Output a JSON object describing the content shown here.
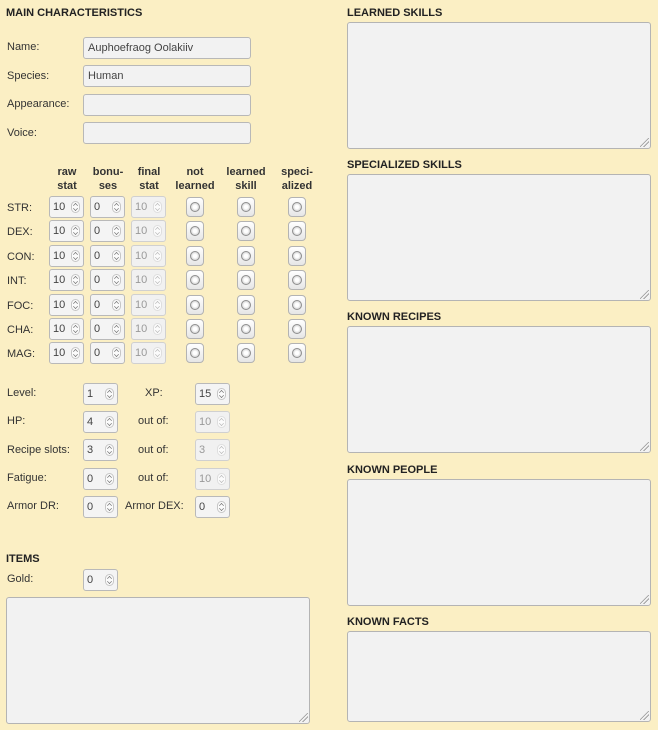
{
  "main": {
    "title": "MAIN CHARACTERISTICS",
    "fields": [
      {
        "label": "Name:",
        "value": "Auphoefraog Oolakiiv"
      },
      {
        "label": "Species:",
        "value": "Human"
      },
      {
        "label": "Appearance:",
        "value": ""
      },
      {
        "label": "Voice:",
        "value": ""
      }
    ]
  },
  "stats": {
    "headers": {
      "raw": [
        "raw",
        "stat"
      ],
      "bonuses": [
        "bonu-",
        "ses"
      ],
      "final": [
        "final",
        "stat"
      ],
      "not_learned": [
        "not",
        "learned"
      ],
      "learned": [
        "learned",
        "skill"
      ],
      "specialized": [
        "speci-",
        "alized"
      ]
    },
    "rows": [
      {
        "label": "STR:",
        "raw": "10",
        "bonus": "0",
        "final": "10"
      },
      {
        "label": "DEX:",
        "raw": "10",
        "bonus": "0",
        "final": "10"
      },
      {
        "label": "CON:",
        "raw": "10",
        "bonus": "0",
        "final": "10"
      },
      {
        "label": "INT:",
        "raw": "10",
        "bonus": "0",
        "final": "10"
      },
      {
        "label": "FOC:",
        "raw": "10",
        "bonus": "0",
        "final": "10"
      },
      {
        "label": "CHA:",
        "raw": "10",
        "bonus": "0",
        "final": "10"
      },
      {
        "label": "MAG:",
        "raw": "10",
        "bonus": "0",
        "final": "10"
      }
    ]
  },
  "progress": {
    "level_label": "Level:",
    "level": "1",
    "xp_label": "XP:",
    "xp": "15",
    "hp_label": "HP:",
    "hp": "4",
    "hp_outof_label": "out of:",
    "hp_max": "10",
    "recipe_label": "Recipe slots:",
    "recipe": "3",
    "recipe_outof_label": "out of:",
    "recipe_max": "3",
    "fatigue_label": "Fatigue:",
    "fatigue": "0",
    "fatigue_outof_label": "out of:",
    "fatigue_max": "10",
    "armor_dr_label": "Armor DR:",
    "armor_dr": "0",
    "armor_dex_label": "Armor DEX:",
    "armor_dex": "0"
  },
  "items": {
    "title": "ITEMS",
    "gold_label": "Gold:",
    "gold": "0"
  },
  "right": {
    "learned_skills": "LEARNED SKILLS",
    "specialized_skills": "SPECIALIZED SKILLS",
    "known_recipes": "KNOWN RECIPES",
    "known_people": "KNOWN PEOPLE",
    "known_facts": "KNOWN FACTS"
  }
}
